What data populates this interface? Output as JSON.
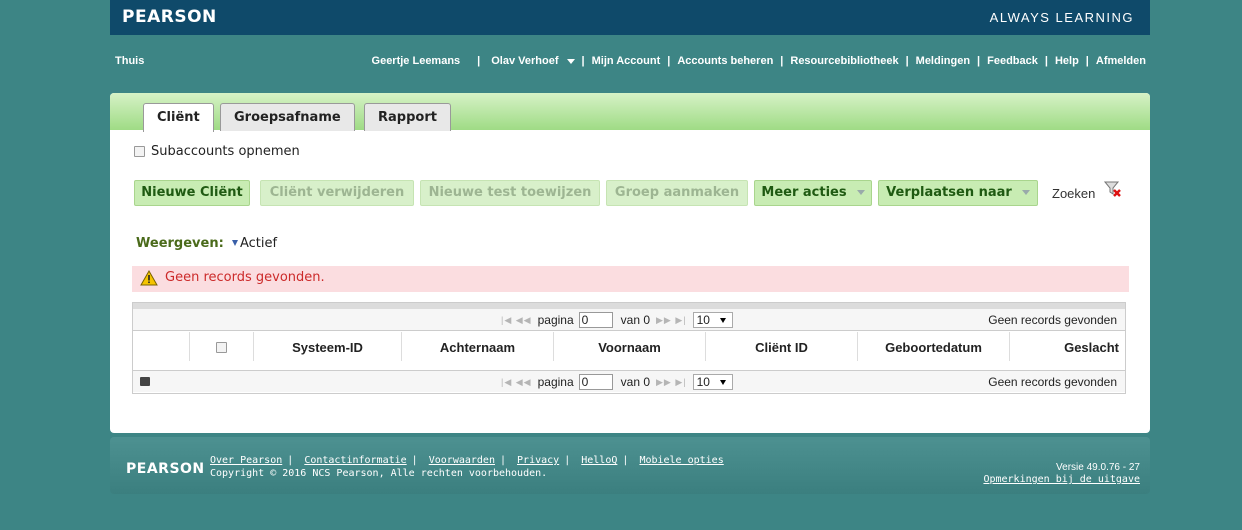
{
  "header": {
    "brand": "PEARSON",
    "tagline": "ALWAYS LEARNING"
  },
  "nav": {
    "home": "Thuis",
    "user": "Geertje Leemans",
    "impersonated": "Olav Verhoef",
    "links": [
      "Mijn Account",
      "Accounts beheren",
      "Resourcebibliotheek",
      "Meldingen",
      "Feedback",
      "Help",
      "Afmelden"
    ],
    "sep": "|"
  },
  "tabs": [
    {
      "label": "Cliënt",
      "active": true
    },
    {
      "label": "Groepsafname",
      "active": false
    },
    {
      "label": "Rapport",
      "active": false
    }
  ],
  "subaccounts_label": "Subaccounts opnemen",
  "toolbar": {
    "new_client": "Nieuwe Cliënt",
    "delete_client": "Cliënt verwijderen",
    "assign_test": "Nieuwe test toewijzen",
    "create_group": "Groep aanmaken",
    "more_actions": "Meer acties",
    "move_to": "Verplaatsen naar",
    "search": "Zoeken"
  },
  "view": {
    "label": "Weergeven:",
    "value": "Actief"
  },
  "alert": {
    "text": "Geen records gevonden."
  },
  "pager": {
    "page_label": "pagina",
    "page_value": "0",
    "of_label": "van 0",
    "page_size": "10",
    "status": "Geen records gevonden"
  },
  "table": {
    "columns": [
      "Systeem-ID",
      "Achternaam",
      "Voornaam",
      "Cliënt ID",
      "Geboortedatum",
      "Geslacht"
    ]
  },
  "footer": {
    "brand": "PEARSON",
    "links": [
      "Over Pearson",
      "Contactinformatie",
      "Voorwaarden",
      "Privacy",
      "HelloQ",
      "Mobiele opties"
    ],
    "copyright": "Copyright © 2016 NCS Pearson, Alle rechten voorbehouden.",
    "version": "Versie 49.0.76 - 27",
    "release_notes": "Opmerkingen bij de uitgave"
  },
  "colors": {
    "header_bg": "#0f4a6a",
    "page_bg": "#3d8585",
    "tab_bar": "#9fdb85",
    "button_bg": "#c8ecb3",
    "alert_bg": "#fbdde0",
    "alert_text": "#cc2a2a"
  }
}
